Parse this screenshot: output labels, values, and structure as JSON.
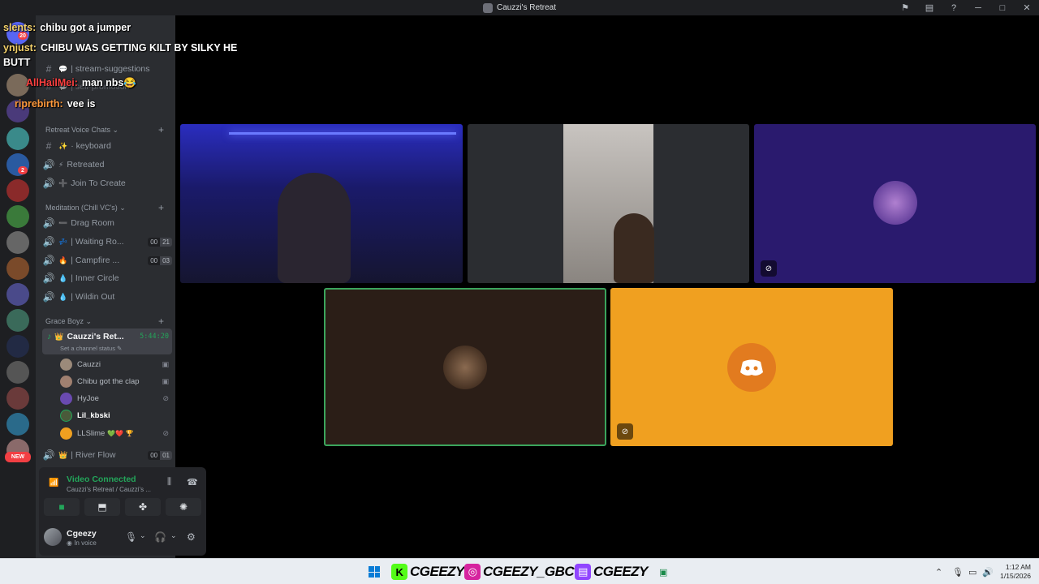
{
  "window": {
    "title": "Cauzzi's Retreat"
  },
  "chat": [
    {
      "user": "slents:",
      "user_color": "#f5d26b",
      "text": "chibu got a jumper"
    },
    {
      "user": "ynjust:",
      "user_color": "#f5d26b",
      "text": "CHIBU WAS GETTING KILT BY SILKY HE"
    },
    {
      "user": "",
      "user_color": "#ffffff",
      "text": "BUTT"
    },
    {
      "user": "AllHailMei:",
      "user_color": "#ff4040",
      "text": "man nbs😂"
    },
    {
      "user": "riprebirth:",
      "user_color": "#ff9a3c",
      "text": "vee is"
    }
  ],
  "sidebar": {
    "channels_top": [
      {
        "icon": "#",
        "emoji": "💬",
        "label": "| stream-suggestions"
      },
      {
        "icon": "#",
        "emoji": "💬",
        "label": "| self-promotion"
      }
    ],
    "cat_voice": "Retreat Voice Chats",
    "voice_channels": [
      {
        "icon": "#",
        "emoji": "✨",
        "label": "· keyboard"
      },
      {
        "icon": "🔊",
        "emoji": "⚡",
        "label": "Retreated"
      },
      {
        "icon": "🔊",
        "emoji": "➕",
        "label": "Join To Create"
      }
    ],
    "cat_meditation": "Meditation (Chill VC's)",
    "meditation_channels": [
      {
        "icon": "🔊",
        "emoji": "➖",
        "label": "Drag Room",
        "c1": "",
        "c2": ""
      },
      {
        "icon": "🔊",
        "emoji": "💤",
        "label": "| Waiting Ro...",
        "c1": "00",
        "c2": "21"
      },
      {
        "icon": "🔊",
        "emoji": "🔥",
        "label": "| Campfire ...",
        "c1": "00",
        "c2": "03"
      },
      {
        "icon": "🔊",
        "emoji": "💧",
        "label": "| Inner Circle",
        "c1": "",
        "c2": ""
      },
      {
        "icon": "🔊",
        "emoji": "💧",
        "label": "| Wildin Out",
        "c1": "",
        "c2": ""
      }
    ],
    "cat_grace": "Grace Boyz",
    "active_channel": {
      "name": "Cauzzi's Ret...",
      "timer": "5:44:20",
      "status": "Set a channel status"
    },
    "members": [
      {
        "name": "Cauzzi",
        "color": "#b5bac1",
        "icon": "▣"
      },
      {
        "name": "Chibu got the clap",
        "color": "#b5bac1",
        "icon": "▣"
      },
      {
        "name": "HyJoe",
        "color": "#b5bac1",
        "icon": "⊘"
      },
      {
        "name": "Lil_kbski",
        "color": "#ffffff",
        "icon": ""
      },
      {
        "name": "LLSlime",
        "color": "#b5bac1",
        "icon": "⊘"
      }
    ],
    "river": {
      "label": "| River Flow",
      "c1": "00",
      "c2": "01"
    }
  },
  "voice_panel": {
    "title": "Video Connected",
    "subtitle": "Cauzzi's Retreat / Cauzzi's ..."
  },
  "user_panel": {
    "name": "Cgeezy",
    "status": "In voice"
  },
  "rail": {
    "badge_top": "20",
    "badge_mid": "2",
    "new_label": "NEW"
  },
  "taskbar": {
    "kick": "CGEEZY",
    "instagram": "CGEEZY_GBC",
    "twitch": "CGEEZY",
    "time": "1:12 AM",
    "date": "1/15/2026"
  },
  "colors": {
    "accent_green": "#23a55a",
    "tile_orange": "#f0a020",
    "tile_purple": "#2a1a6e",
    "tile_brown": "#2b1e17"
  }
}
